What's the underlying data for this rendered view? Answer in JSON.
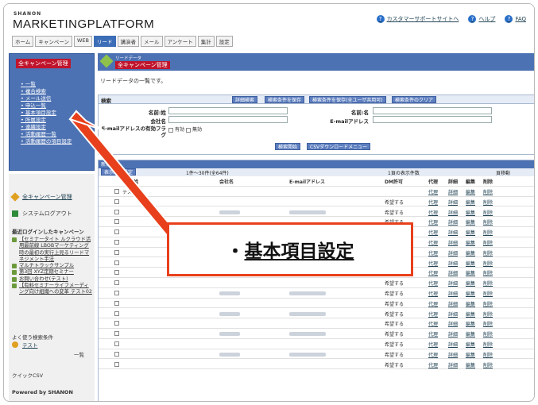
{
  "brand": {
    "small": "SHANON",
    "big": "MARKETINGPLATFORM"
  },
  "header_links": [
    "カスタマーサポートサイトへ",
    "ヘルプ",
    "FAQ"
  ],
  "tabs": [
    "ホーム",
    "キャンペーン",
    "WEB",
    "リード",
    "講演者",
    "メール",
    "アンケート",
    "集計",
    "設定"
  ],
  "active_tab": "リード",
  "sidebar": {
    "title": "全キャンペーン管理",
    "items": [
      "一覧",
      "複合検索",
      "メール送信",
      "申込一覧",
      "基本項目設定",
      "所属設定",
      "連續設定",
      "活動履歴一覧",
      "活動履歴の項目設定"
    ],
    "campaign_link": "全キャンペーン管理",
    "logout": "システムログアウト",
    "recent_title": "最近ログインしたキャンペーン",
    "recent": [
      "【セミナータイト ルクラウド活用最前線 LBOBマーケティング時の最初の実行上見るリードマネジメント手法",
      "マルチトラックサンプル",
      "第3回 XYZ定期セミナー",
      "お問い合わせ(テスト)",
      "【有料セミナーライフメーディング向け組織への変革 テスト02"
    ],
    "quick_title": "よく使う検索条件",
    "quick_item": "テスト",
    "quick_list": "一覧",
    "quick_csv": "クイックCSV",
    "powered": "Powered by SHANON"
  },
  "main": {
    "sub": "リードデータ",
    "title": "全キャンペーン管理",
    "desc": "リードデータの一覧です。",
    "search_label": "検索",
    "search_buttons": [
      "詳細検索",
      "検索条件を保存",
      "検索条件を保存(全ユーザ共用可)",
      "検索条件のクリア"
    ],
    "fields": {
      "name_sei": "名前:姓",
      "name_mei": "名前:名",
      "company": "会社名",
      "email": "E-mailアドレス",
      "email_flag": "E-mailアドレスの有効フラグ",
      "valid": "有効",
      "invalid": "無効"
    },
    "btn_search": "検索開始",
    "btn_csv": "CSVダウンロードメニュー",
    "list_bar": "新規登録",
    "show_btn": "表示項目設定",
    "range": "1件〜30件(全64件)",
    "per_page": "1頁の表示件数",
    "page_move": "頁移動",
    "columns": [
      "名前:姓",
      "会社名",
      "E-mailアドレス",
      "DM許可",
      "代理",
      "詳細",
      "編集",
      "削除"
    ],
    "rows": [
      {
        "name": "テスト",
        "dm": ""
      },
      {
        "name": "",
        "dm": "希望する"
      },
      {
        "name": "",
        "dm": "希望する"
      },
      {
        "name": "",
        "dm": "希望する"
      },
      {
        "name": "",
        "dm": "希望する"
      },
      {
        "name": "",
        "dm": "希望する"
      },
      {
        "name": "",
        "dm": "希望する"
      },
      {
        "name": "",
        "dm": "希望する"
      },
      {
        "name": "",
        "dm": "希望する"
      },
      {
        "name": "",
        "dm": "希望する"
      },
      {
        "name": "",
        "dm": "希望する"
      },
      {
        "name": "",
        "dm": "希望する"
      },
      {
        "name": "",
        "dm": "希望する"
      },
      {
        "name": "",
        "dm": "希望する"
      },
      {
        "name": "",
        "dm": "希望する"
      },
      {
        "name": "",
        "dm": "希望する"
      },
      {
        "name": "",
        "dm": "希望する"
      },
      {
        "name": "",
        "dm": "希望する"
      }
    ],
    "row_links": [
      "代理",
      "詳細",
      "編集",
      "削除"
    ]
  },
  "callout": {
    "bullet": "・",
    "text": "基本項目設定"
  },
  "colors": {
    "accent": "#e8401c",
    "nav": "#4d72b3",
    "title_red": "#c0142c"
  }
}
